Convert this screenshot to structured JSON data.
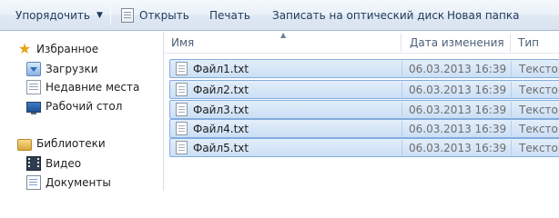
{
  "toolbar": {
    "organize_label": "Упорядочить",
    "open_label": "Открыть",
    "print_label": "Печать",
    "burn_label": "Записать на оптический диск",
    "new_folder_label": "Новая папка"
  },
  "nav": {
    "favorites": {
      "label": "Избранное",
      "items": [
        {
          "label": "Загрузки",
          "icon": "downloads-icon"
        },
        {
          "label": "Недавние места",
          "icon": "recent-places-icon"
        },
        {
          "label": "Рабочий стол",
          "icon": "desktop-icon"
        }
      ]
    },
    "libraries": {
      "label": "Библиотеки",
      "items": [
        {
          "label": "Видео",
          "icon": "video-icon"
        },
        {
          "label": "Документы",
          "icon": "documents-icon"
        }
      ]
    }
  },
  "columns": {
    "name": "Имя",
    "date": "Дата изменения",
    "type": "Тип"
  },
  "files": [
    {
      "name": "Файл1.txt",
      "date": "06.03.2013 16:39",
      "type": "Текстовый"
    },
    {
      "name": "Файл2.txt",
      "date": "06.03.2013 16:39",
      "type": "Текстовый"
    },
    {
      "name": "Файл3.txt",
      "date": "06.03.2013 16:39",
      "type": "Текстовый"
    },
    {
      "name": "Файл4.txt",
      "date": "06.03.2013 16:39",
      "type": "Текстовый"
    },
    {
      "name": "Файл5.txt",
      "date": "06.03.2013 16:39",
      "type": "Текстовый"
    }
  ],
  "colors": {
    "selection_fill": "#cbdff5",
    "selection_border": "#84acdd",
    "toolbar_text": "#1e395b"
  }
}
